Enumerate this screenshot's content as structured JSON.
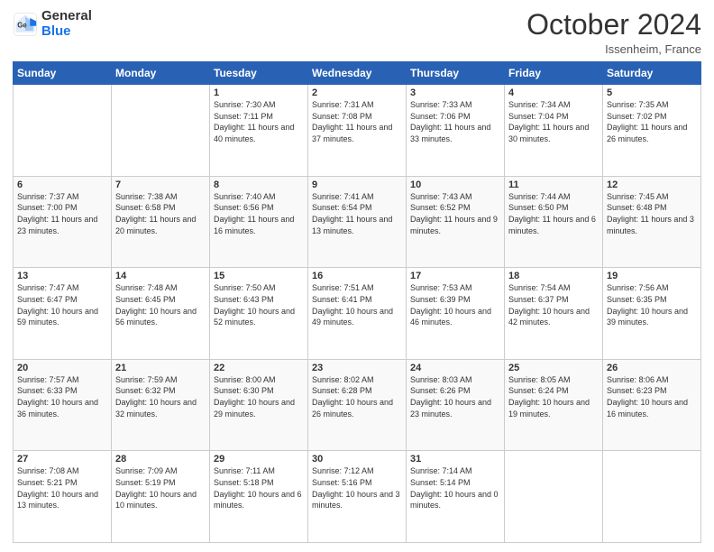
{
  "header": {
    "logo_general": "General",
    "logo_blue": "Blue",
    "month_title": "October 2024",
    "location": "Issenheim, France"
  },
  "weekdays": [
    "Sunday",
    "Monday",
    "Tuesday",
    "Wednesday",
    "Thursday",
    "Friday",
    "Saturday"
  ],
  "weeks": [
    [
      {
        "day": "",
        "info": ""
      },
      {
        "day": "",
        "info": ""
      },
      {
        "day": "1",
        "info": "Sunrise: 7:30 AM\nSunset: 7:11 PM\nDaylight: 11 hours and 40 minutes."
      },
      {
        "day": "2",
        "info": "Sunrise: 7:31 AM\nSunset: 7:08 PM\nDaylight: 11 hours and 37 minutes."
      },
      {
        "day": "3",
        "info": "Sunrise: 7:33 AM\nSunset: 7:06 PM\nDaylight: 11 hours and 33 minutes."
      },
      {
        "day": "4",
        "info": "Sunrise: 7:34 AM\nSunset: 7:04 PM\nDaylight: 11 hours and 30 minutes."
      },
      {
        "day": "5",
        "info": "Sunrise: 7:35 AM\nSunset: 7:02 PM\nDaylight: 11 hours and 26 minutes."
      }
    ],
    [
      {
        "day": "6",
        "info": "Sunrise: 7:37 AM\nSunset: 7:00 PM\nDaylight: 11 hours and 23 minutes."
      },
      {
        "day": "7",
        "info": "Sunrise: 7:38 AM\nSunset: 6:58 PM\nDaylight: 11 hours and 20 minutes."
      },
      {
        "day": "8",
        "info": "Sunrise: 7:40 AM\nSunset: 6:56 PM\nDaylight: 11 hours and 16 minutes."
      },
      {
        "day": "9",
        "info": "Sunrise: 7:41 AM\nSunset: 6:54 PM\nDaylight: 11 hours and 13 minutes."
      },
      {
        "day": "10",
        "info": "Sunrise: 7:43 AM\nSunset: 6:52 PM\nDaylight: 11 hours and 9 minutes."
      },
      {
        "day": "11",
        "info": "Sunrise: 7:44 AM\nSunset: 6:50 PM\nDaylight: 11 hours and 6 minutes."
      },
      {
        "day": "12",
        "info": "Sunrise: 7:45 AM\nSunset: 6:48 PM\nDaylight: 11 hours and 3 minutes."
      }
    ],
    [
      {
        "day": "13",
        "info": "Sunrise: 7:47 AM\nSunset: 6:47 PM\nDaylight: 10 hours and 59 minutes."
      },
      {
        "day": "14",
        "info": "Sunrise: 7:48 AM\nSunset: 6:45 PM\nDaylight: 10 hours and 56 minutes."
      },
      {
        "day": "15",
        "info": "Sunrise: 7:50 AM\nSunset: 6:43 PM\nDaylight: 10 hours and 52 minutes."
      },
      {
        "day": "16",
        "info": "Sunrise: 7:51 AM\nSunset: 6:41 PM\nDaylight: 10 hours and 49 minutes."
      },
      {
        "day": "17",
        "info": "Sunrise: 7:53 AM\nSunset: 6:39 PM\nDaylight: 10 hours and 46 minutes."
      },
      {
        "day": "18",
        "info": "Sunrise: 7:54 AM\nSunset: 6:37 PM\nDaylight: 10 hours and 42 minutes."
      },
      {
        "day": "19",
        "info": "Sunrise: 7:56 AM\nSunset: 6:35 PM\nDaylight: 10 hours and 39 minutes."
      }
    ],
    [
      {
        "day": "20",
        "info": "Sunrise: 7:57 AM\nSunset: 6:33 PM\nDaylight: 10 hours and 36 minutes."
      },
      {
        "day": "21",
        "info": "Sunrise: 7:59 AM\nSunset: 6:32 PM\nDaylight: 10 hours and 32 minutes."
      },
      {
        "day": "22",
        "info": "Sunrise: 8:00 AM\nSunset: 6:30 PM\nDaylight: 10 hours and 29 minutes."
      },
      {
        "day": "23",
        "info": "Sunrise: 8:02 AM\nSunset: 6:28 PM\nDaylight: 10 hours and 26 minutes."
      },
      {
        "day": "24",
        "info": "Sunrise: 8:03 AM\nSunset: 6:26 PM\nDaylight: 10 hours and 23 minutes."
      },
      {
        "day": "25",
        "info": "Sunrise: 8:05 AM\nSunset: 6:24 PM\nDaylight: 10 hours and 19 minutes."
      },
      {
        "day": "26",
        "info": "Sunrise: 8:06 AM\nSunset: 6:23 PM\nDaylight: 10 hours and 16 minutes."
      }
    ],
    [
      {
        "day": "27",
        "info": "Sunrise: 7:08 AM\nSunset: 5:21 PM\nDaylight: 10 hours and 13 minutes."
      },
      {
        "day": "28",
        "info": "Sunrise: 7:09 AM\nSunset: 5:19 PM\nDaylight: 10 hours and 10 minutes."
      },
      {
        "day": "29",
        "info": "Sunrise: 7:11 AM\nSunset: 5:18 PM\nDaylight: 10 hours and 6 minutes."
      },
      {
        "day": "30",
        "info": "Sunrise: 7:12 AM\nSunset: 5:16 PM\nDaylight: 10 hours and 3 minutes."
      },
      {
        "day": "31",
        "info": "Sunrise: 7:14 AM\nSunset: 5:14 PM\nDaylight: 10 hours and 0 minutes."
      },
      {
        "day": "",
        "info": ""
      },
      {
        "day": "",
        "info": ""
      }
    ]
  ]
}
